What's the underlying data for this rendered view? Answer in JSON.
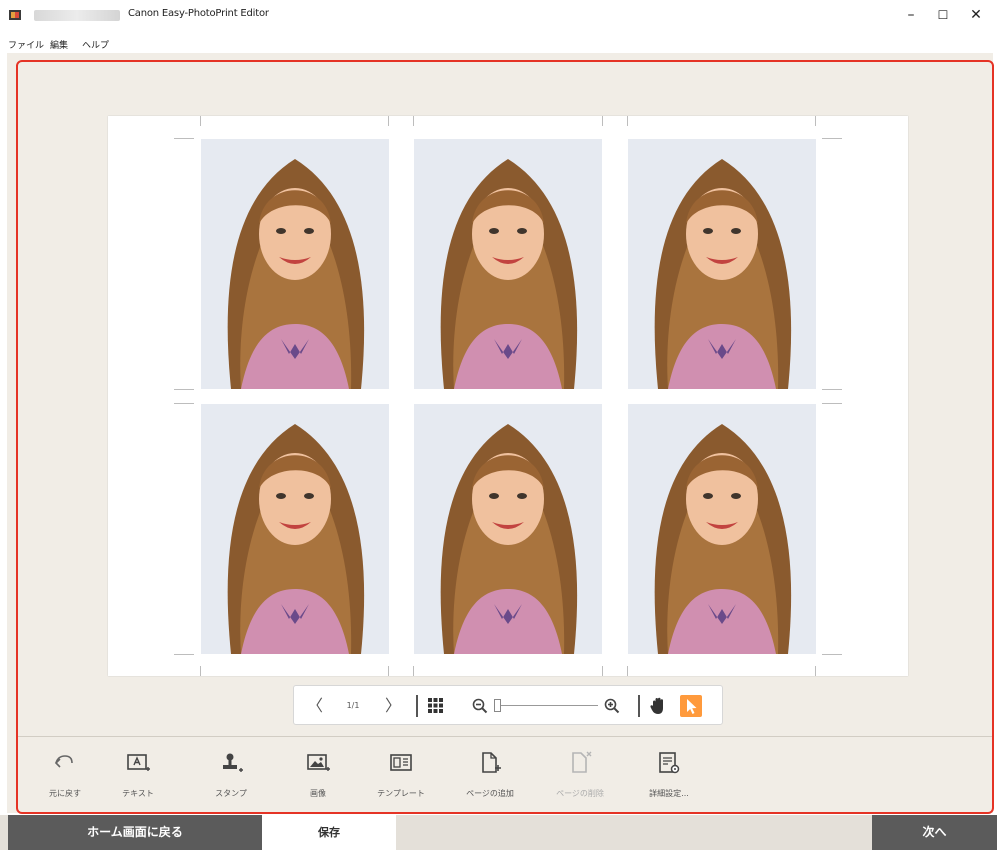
{
  "titlebar": {
    "title": "Canon Easy-PhotoPrint Editor",
    "minimize": "–",
    "maximize": "☐",
    "close": "✕"
  },
  "menu": [
    "ファイル",
    "編集",
    "ヘルプ"
  ],
  "colors": {
    "accent_frame": "#e53325",
    "workspace_bg": "#f1ede6",
    "footer_btn": "#5b5b5b",
    "pointer_active": "#ff9a3c"
  },
  "photo_sheet": {
    "layout": "2 rows × 3 columns",
    "photos": [
      {
        "icon": "portrait-photo"
      },
      {
        "icon": "portrait-photo"
      },
      {
        "icon": "portrait-photo"
      },
      {
        "icon": "portrait-photo"
      },
      {
        "icon": "portrait-photo"
      },
      {
        "icon": "portrait-photo"
      }
    ]
  },
  "zoombar": {
    "prev": "〈",
    "page_indicator": "1/1",
    "next": "〉",
    "zoom_level": 0.0
  },
  "tools": [
    {
      "label": "元に戻す",
      "icon": "undo-icon",
      "enabled": true
    },
    {
      "label": "テキスト",
      "icon": "add-text-icon",
      "enabled": true
    },
    {
      "label": "スタンプ",
      "icon": "add-stamp-icon",
      "enabled": true
    },
    {
      "label": "画像",
      "icon": "add-image-icon",
      "enabled": true
    },
    {
      "label": "テンプレート",
      "icon": "template-icon",
      "enabled": true
    },
    {
      "label": "ページの追加",
      "icon": "add-page-icon",
      "enabled": true
    },
    {
      "label": "ページの削除",
      "icon": "delete-page-icon",
      "enabled": false
    },
    {
      "label": "詳細設定...",
      "icon": "advanced-settings-icon",
      "enabled": true
    }
  ],
  "footer": {
    "home": "ホーム画面に戻る",
    "save": "保存",
    "next": "次へ"
  }
}
